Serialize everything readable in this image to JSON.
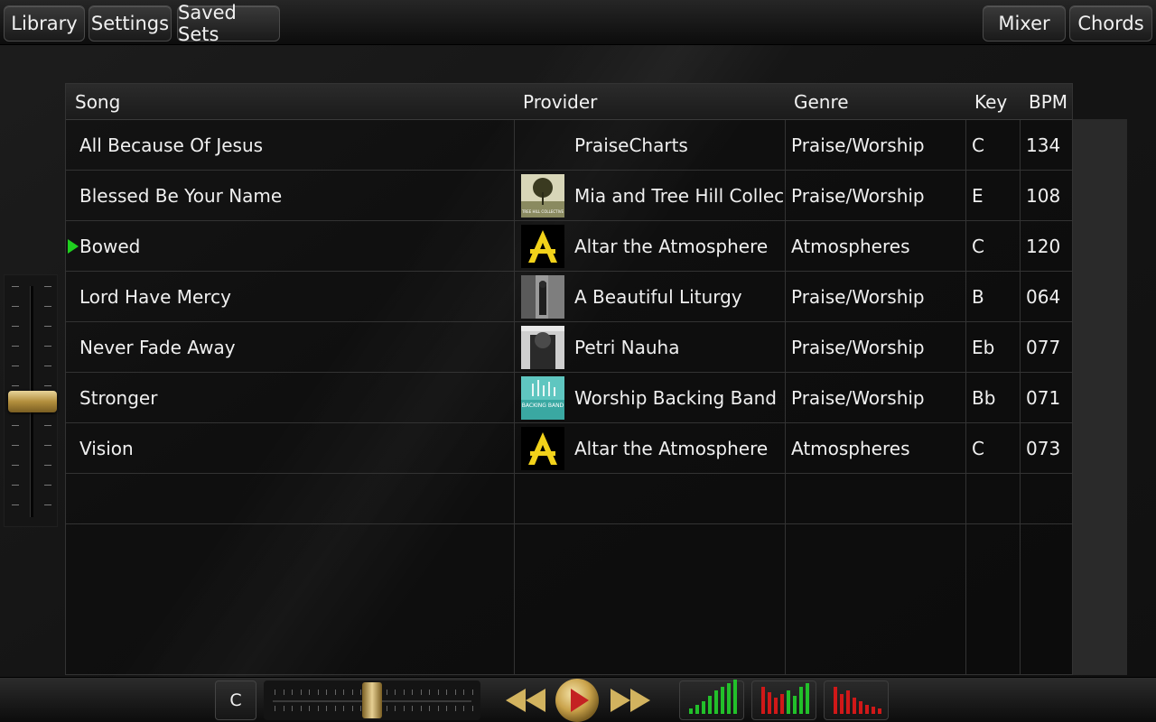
{
  "topbar": {
    "library": "Library",
    "settings": "Settings",
    "saved_sets": "Saved Sets",
    "mixer": "Mixer",
    "chords": "Chords"
  },
  "table": {
    "headers": {
      "song": "Song",
      "provider": "Provider",
      "genre": "Genre",
      "key": "Key",
      "bpm": "BPM"
    },
    "rows": [
      {
        "song": "All Because Of Jesus",
        "provider": "PraiseCharts",
        "genre": "Praise/Worship",
        "key": "C",
        "bpm": "134",
        "thumb": "none",
        "playing": false
      },
      {
        "song": "Blessed Be Your Name",
        "provider": "Mia and Tree Hill Collective",
        "genre": "Praise/Worship",
        "key": "E",
        "bpm": "108",
        "thumb": "tree-hill-cover",
        "playing": false
      },
      {
        "song": "Bowed",
        "provider": "Altar the Atmosphere",
        "genre": "Atmospheres",
        "key": "C",
        "bpm": "120",
        "thumb": "altar-logo",
        "playing": true
      },
      {
        "song": "Lord Have Mercy",
        "provider": "A Beautiful Liturgy",
        "genre": "Praise/Worship",
        "key": "B",
        "bpm": "064",
        "thumb": "liturgy-cover",
        "playing": false
      },
      {
        "song": "Never Fade Away",
        "provider": "Petri Nauha",
        "genre": "Praise/Worship",
        "key": "Eb",
        "bpm": "077",
        "thumb": "petri-cover",
        "playing": false
      },
      {
        "song": "Stronger",
        "provider": "Worship Backing Band",
        "genre": "Praise/Worship",
        "key": "Bb",
        "bpm": "071",
        "thumb": "backing-band-cover",
        "playing": false
      },
      {
        "song": "Vision",
        "provider": "Altar the Atmosphere",
        "genre": "Atmospheres",
        "key": "C",
        "bpm": "073",
        "thumb": "altar-logo",
        "playing": false
      }
    ]
  },
  "thumb_text": {
    "tree_hill": "TREE HILL COLLECTIVE",
    "backing_band": "BACKING BAND"
  },
  "volume": {
    "level": 0.5
  },
  "bottombar": {
    "key_label": "C",
    "tempo_level": 0.5,
    "transport": [
      "rewind-icon",
      "play-icon",
      "fast-forward-icon"
    ],
    "meters": [
      "green-level-meter",
      "red-green-level-meter",
      "red-level-meter"
    ]
  },
  "colors": {
    "accent_gold": "#c9a24a",
    "play_marker": "#1fd01f",
    "meter_green": "#22c02a",
    "meter_red": "#d01818"
  }
}
